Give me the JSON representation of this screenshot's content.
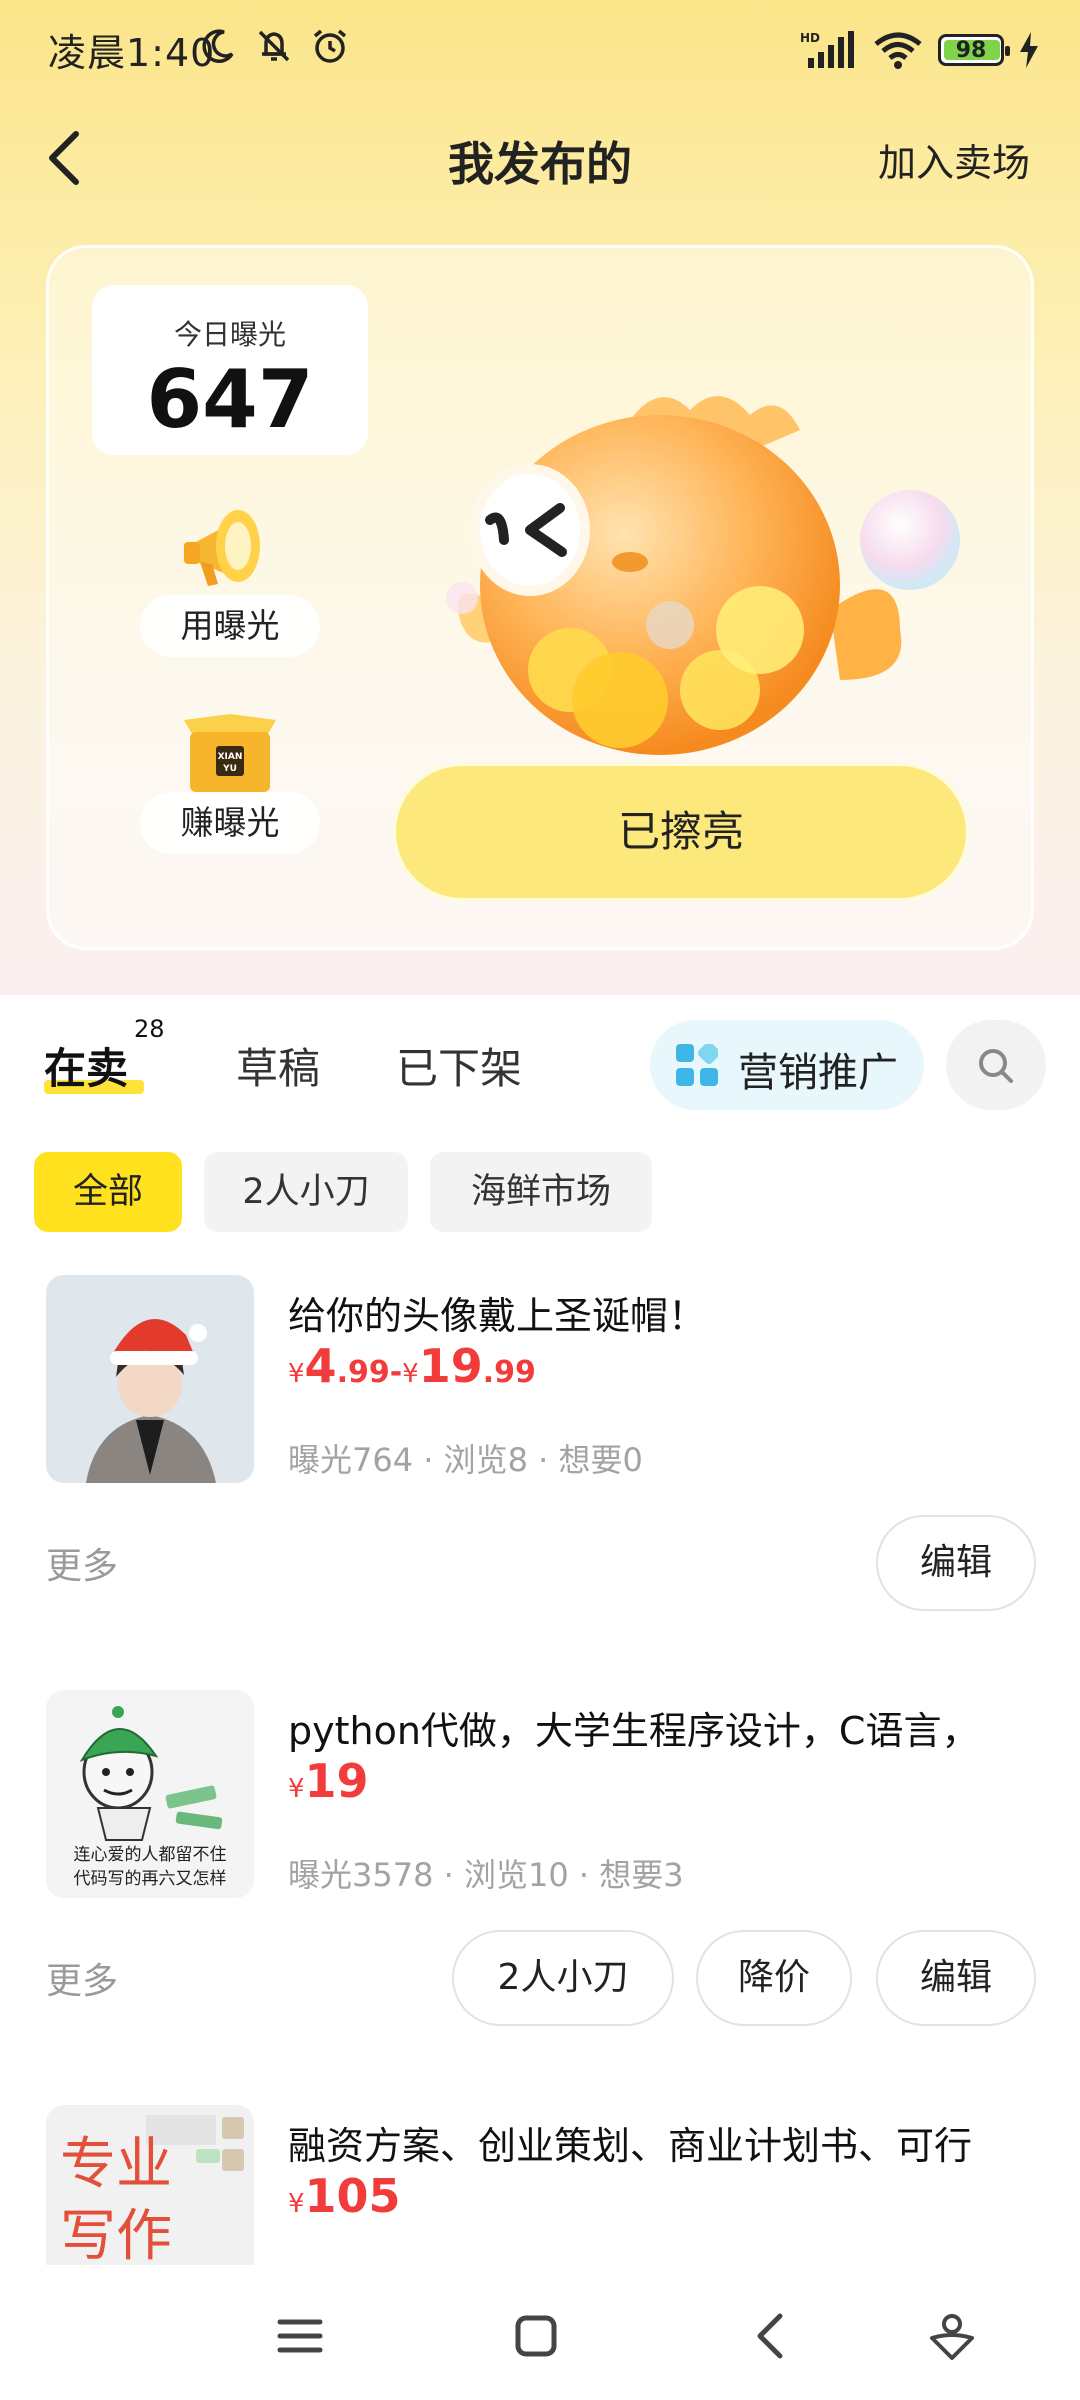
{
  "status_bar": {
    "time": "凌晨1:40",
    "network": "HD",
    "battery": "98"
  },
  "header": {
    "title": "我发布的",
    "join_label": "加入卖场"
  },
  "exposure": {
    "today_label": "今日曝光",
    "today_value": "647",
    "use_label": "用曝光",
    "earn_label": "赚曝光",
    "box_text": "XIAN YU",
    "shine_label": "已擦亮"
  },
  "tabs": [
    {
      "label": "在卖",
      "badge": "28",
      "active": true
    },
    {
      "label": "草稿"
    },
    {
      "label": "已下架"
    }
  ],
  "promo_label": "营销推广",
  "filters": [
    "全部",
    "2人小刀",
    "海鲜市场"
  ],
  "items": [
    {
      "title": "给你的头像戴上圣诞帽！",
      "price": {
        "currency": "¥",
        "min_int": "4",
        "min_dec": ".99",
        "sep": "-",
        "max_int": "19",
        "max_dec": ".99"
      },
      "stats": "曝光764 · 浏览8 · 想要0",
      "more": "更多",
      "actions": [
        "编辑"
      ]
    },
    {
      "title": "python代做，大学生程序设计，C语言，",
      "price": {
        "currency": "¥",
        "value": "19"
      },
      "stats": "曝光3578 · 浏览10 · 想要3",
      "more": "更多",
      "actions": [
        "2人小刀",
        "降价",
        "编辑"
      ],
      "thumb_caption": [
        "连心爱的人都留不住",
        "代码写的再六又怎样"
      ]
    },
    {
      "title": "融资方案、创业策划、商业计划书、可行",
      "price": {
        "currency": "¥",
        "value": "105"
      },
      "thumb_caption": [
        "专业",
        "写作"
      ]
    }
  ],
  "colors": {
    "accent_yellow": "#ffe11e",
    "price_red": "#f23b3b",
    "shine_button": "#fde97b"
  },
  "icons": [
    "back-arrow-icon",
    "moon-icon",
    "mute-icon",
    "alarm-icon",
    "signal-icon",
    "wifi-icon",
    "battery-icon",
    "charging-icon",
    "megaphone-icon",
    "box-icon",
    "grid-icon",
    "search-icon",
    "menu-icon",
    "home-icon",
    "back-icon",
    "assistant-icon"
  ]
}
